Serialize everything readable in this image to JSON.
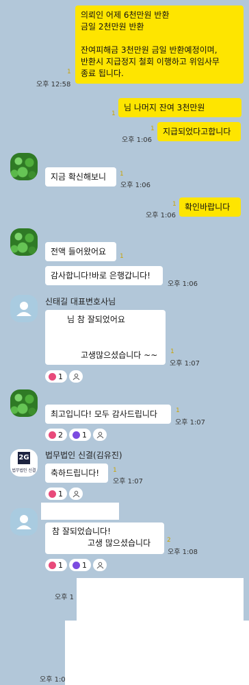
{
  "messages": {
    "m1": {
      "text": "의뢰인 어제 6천만원 반환\n금일 2천만원 반환\n\n잔여피해금 3천만원 금일 반환예정이며,\n반환시 지급정지 철회 이행하고 위임사무\n종료 됩니다.",
      "time": "오후 12:58",
      "unread": "1"
    },
    "m2": {
      "text": "님 나머지 잔여 3천만원",
      "unread": "1"
    },
    "m3": {
      "text": "지급되었다고합니다",
      "time": "오후 1:06",
      "unread": "1"
    },
    "m4": {
      "text": "지금 확신해보니",
      "time": "오후 1:06",
      "unread": "1"
    },
    "m5": {
      "text": "확인바랍니다",
      "time": "오후 1:06",
      "unread": "1"
    },
    "m6": {
      "text": "전액 들어왔어요",
      "unread": "1"
    },
    "m7": {
      "text": "감사합니다!바로 은행갑니다!",
      "time": "오후 1:06"
    },
    "m8": {
      "sender": "신태길 대표변호사님",
      "line1": "님 참 잘되었어요",
      "line2": "고생많으셨습니다 ~~",
      "time": "오후 1:07",
      "unread": "1",
      "heart_count": "1"
    },
    "m9": {
      "text": "최고입니다! 모두 감사드립니다",
      "time": "오후 1:07",
      "unread": "1",
      "heart_count": "2",
      "thumb_count": "1"
    },
    "m10": {
      "sender": "법무법인 신결(김유진)",
      "logo_text": "법무법인 신결",
      "logo_mark": "2G",
      "text": "축하드립니다!",
      "time": "오후 1:07",
      "unread": "1",
      "heart_count": "1"
    },
    "m11": {
      "line1": "참 잘되었습니다!",
      "line2": "고생 많으셨습니다",
      "time": "오후 1:08",
      "unread": "2",
      "heart_count": "1",
      "thumb_count": "1"
    },
    "m12": {
      "time": "오후 1"
    },
    "m13": {
      "time": "오후 1:0"
    }
  },
  "icons": {
    "reaction_heart": "heart-icon",
    "reaction_thumb": "thumb-icon",
    "user": "person-icon"
  }
}
